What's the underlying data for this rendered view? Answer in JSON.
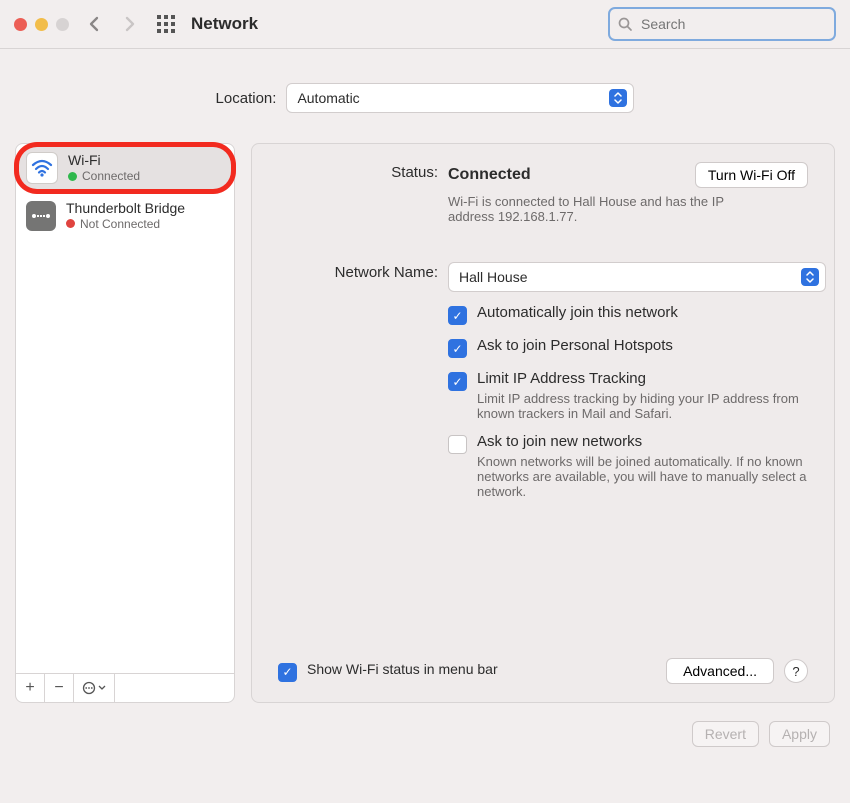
{
  "header": {
    "title": "Network",
    "search_placeholder": "Search"
  },
  "location": {
    "label": "Location:",
    "selected": "Automatic"
  },
  "sidebar": {
    "items": [
      {
        "name": "Wi-Fi",
        "status": "Connected",
        "color": "green",
        "selected": true,
        "highlighted": true,
        "icon": "wifi"
      },
      {
        "name": "Thunderbolt Bridge",
        "status": "Not Connected",
        "color": "red",
        "selected": false,
        "highlighted": false,
        "icon": "thunderbolt"
      }
    ],
    "add_label": "+",
    "remove_label": "−"
  },
  "main": {
    "status_label": "Status:",
    "status_value": "Connected",
    "wifi_off_btn": "Turn Wi-Fi Off",
    "status_desc": "Wi-Fi is connected to Hall House and has the IP address 192.168.1.77.",
    "network_label": "Network Name:",
    "network_selected": "Hall House",
    "checkboxes": [
      {
        "label": "Automatically join this network",
        "checked": true,
        "desc": ""
      },
      {
        "label": "Ask to join Personal Hotspots",
        "checked": true,
        "desc": ""
      },
      {
        "label": "Limit IP Address Tracking",
        "checked": true,
        "desc": "Limit IP address tracking by hiding your IP address from known trackers in Mail and Safari."
      },
      {
        "label": "Ask to join new networks",
        "checked": false,
        "desc": "Known networks will be joined automatically. If no known networks are available, you will have to manually select a network."
      }
    ],
    "menubar_cb": {
      "label": "Show Wi-Fi status in menu bar",
      "checked": true
    },
    "advanced_btn": "Advanced...",
    "help_btn": "?"
  },
  "footer": {
    "revert": "Revert",
    "apply": "Apply"
  }
}
